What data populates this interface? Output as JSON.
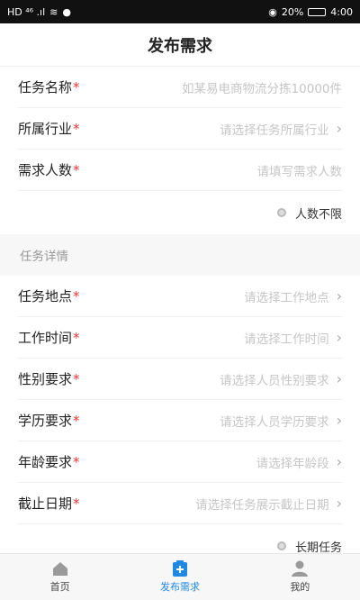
{
  "status_bar": {
    "left": "HD ⁴⁶ .ıl",
    "battery": "20%",
    "time": "4:00",
    "battery_level": 0.2
  },
  "header": {
    "title": "发布需求"
  },
  "form_top": [
    {
      "label": "任务名称",
      "placeholder": "如某易电商物流分拣10000件",
      "chevron": false
    },
    {
      "label": "所属行业",
      "placeholder": "请选择任务所属行业",
      "chevron": true
    },
    {
      "label": "需求人数",
      "placeholder": "请填写需求人数",
      "chevron": false
    }
  ],
  "toggle_unlimited": {
    "label": "人数不限"
  },
  "section": {
    "title": "任务详情"
  },
  "form_details": [
    {
      "label": "任务地点",
      "placeholder": "请选择工作地点"
    },
    {
      "label": "工作时间",
      "placeholder": "请选择工作时间"
    },
    {
      "label": "性别要求",
      "placeholder": "请选择人员性别要求"
    },
    {
      "label": "学历要求",
      "placeholder": "请选择人员学历要求"
    },
    {
      "label": "年龄要求",
      "placeholder": "请选择年龄段"
    },
    {
      "label": "截止日期",
      "placeholder": "请选择任务展示截止日期"
    }
  ],
  "toggle_long_term": {
    "label": "长期任务"
  },
  "required_mark": "*",
  "chevron_glyph": "›",
  "nav": {
    "items": [
      {
        "label": "首页",
        "icon": "home-icon",
        "active": false
      },
      {
        "label": "发布需求",
        "icon": "publish-icon",
        "active": true
      },
      {
        "label": "我的",
        "icon": "profile-icon",
        "active": false
      }
    ]
  },
  "colors": {
    "accent": "#1e88e5",
    "required": "#e53935",
    "placeholder": "#c6c6c6"
  }
}
